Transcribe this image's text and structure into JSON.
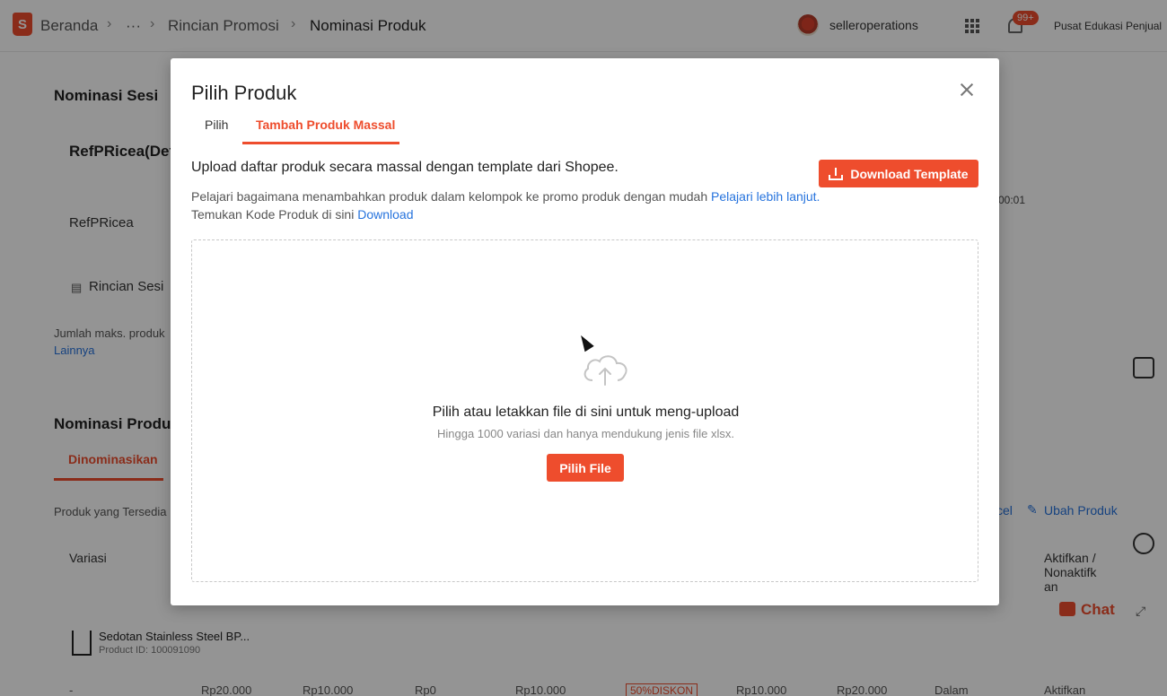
{
  "topbar": {
    "breadcrumbs": [
      "Beranda",
      "···",
      "Rincian Promosi",
      "Nominasi Produk"
    ],
    "username": "selleroperations",
    "notification_count": "99+",
    "edu_link": "Pusat Edukasi Penjual"
  },
  "background": {
    "section_session": "Nominasi Sesi",
    "session_name": "RefPRicea(Def",
    "session_short": "RefPRicea",
    "session_detail": "Rincian Sesi",
    "time_fragment": "00:01",
    "max_products": "Jumlah maks. produk",
    "more_link": "Lainnya",
    "section_products": "Nominasi Produk",
    "tab_nominated": "Dinominasikan",
    "available_products": "Produk yang Tersedia",
    "excel_fragment": "cel",
    "edit_products": "Ubah Produk",
    "col_variation": "Variasi",
    "col_toggle_1": "Aktifkan /",
    "col_toggle_2": "Nonaktifk",
    "col_toggle_3": "an",
    "chat": "Chat",
    "product_name": "Sedotan Stainless Steel BP...",
    "product_id": "Product ID: 100091090",
    "row": {
      "dash": "-",
      "price1": "Rp20.000",
      "price2": "Rp10.000",
      "price3": "Rp0",
      "price4": "Rp10.000",
      "discount": "50%DISKON",
      "price5": "Rp10.000",
      "price6": "Rp20.000",
      "status": "Dalam",
      "action": "Aktifkan"
    }
  },
  "modal": {
    "title": "Pilih Produk",
    "tabs": [
      {
        "label": "Pilih",
        "active": false
      },
      {
        "label": "Tambah Produk Massal",
        "active": true
      }
    ],
    "upload_heading": "Upload daftar produk secara massal dengan template dari Shopee.",
    "download_template": "Download Template",
    "learn_text": "Pelajari bagaimana menambahkan produk dalam kelompok ke promo produk dengan mudah",
    "learn_link": "Pelajari lebih lanjut.",
    "code_text": "Temukan Kode Produk di sini",
    "code_link": "Download",
    "dropzone": {
      "title": "Pilih atau letakkan file di sini untuk meng-upload",
      "subtitle": "Hingga 1000 variasi dan hanya mendukung jenis file xlsx.",
      "button": "Pilih File"
    }
  },
  "colors": {
    "accent": "#ee4d2d",
    "link": "#2673dd"
  }
}
